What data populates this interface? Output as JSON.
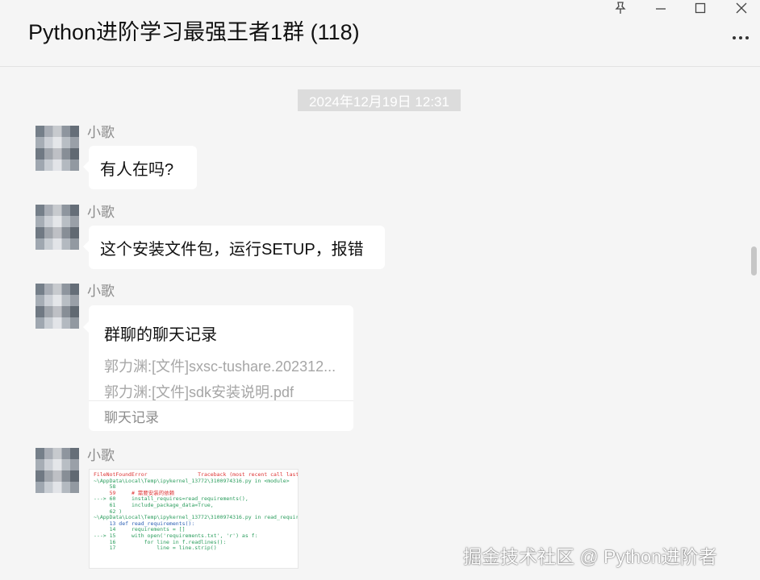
{
  "window": {
    "title": "Python进阶学习最强王者1群 (118)",
    "controls": [
      "pin-icon",
      "minimize-icon",
      "maximize-icon",
      "close-icon"
    ],
    "more_icon": "more-icon"
  },
  "chat": {
    "timestamp": "2024年12月19日 12:31",
    "messages": [
      {
        "sender": "小歌",
        "type": "text",
        "text": "有人在吗?"
      },
      {
        "sender": "小歌",
        "type": "text",
        "text": "这个安装文件包，运行SETUP，报错"
      },
      {
        "sender": "小歌",
        "type": "chat-record",
        "card_title": "群聊的聊天记录",
        "lines": [
          "郭力渊:[文件]sxsc-tushare.202312...",
          "郭力渊:[文件]sdk安装说明.pdf"
        ],
        "footer": "聊天记录"
      },
      {
        "sender": "小歌",
        "type": "image",
        "code_lines": [
          "FileNotFoundError                Traceback (most recent call last)",
          "~\\AppData\\Local\\Temp\\ipykernel_13772\\3100974316.py in <module>",
          "     58",
          "     59     # 需要安装的依赖",
          "---> 60     install_requires=read_requirements(),",
          "     61     include_package_data=True,",
          "     62 )",
          "",
          "~\\AppData\\Local\\Temp\\ipykernel_13772\\3100974316.py in read_requirements()",
          "     13 def read_requirements():",
          "     14     requirements = []",
          "---> 15     with open('requirements.txt', 'r') as f:",
          "     16         for line in f.readlines():",
          "     17             line = line.strip()"
        ]
      }
    ]
  },
  "watermark": "掘金技术社区 @ Python进阶者",
  "colors": {
    "background": "#f5f5f5",
    "bubble": "#ffffff",
    "timestamp_bg": "#dcdcdc",
    "sender": "#8a8a8a"
  }
}
